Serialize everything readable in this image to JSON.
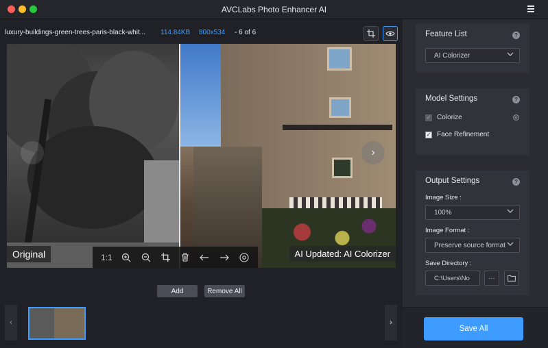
{
  "window": {
    "title": "AVCLabs Photo Enhancer AI"
  },
  "file_info": {
    "name": "luxury-buildings-green-trees-paris-black-whit...",
    "size": "114.84KB",
    "dimensions": "800x534",
    "position": "- 6 of 6"
  },
  "viewer": {
    "label_original": "Original",
    "label_ai": "AI Updated: AI Colorizer",
    "zoom_label": "1:1",
    "next_glyph": "›"
  },
  "actions": {
    "add_label": "Add",
    "remove_all_label": "Remove All"
  },
  "thumbnail_strip": {
    "prev_glyph": "‹",
    "next_glyph": "›"
  },
  "feature_list": {
    "title": "Feature List",
    "help": "?",
    "selected": "AI Colorizer"
  },
  "model_settings": {
    "title": "Model Settings",
    "help": "?",
    "options": [
      {
        "label": "Colorize",
        "checked": true,
        "disabled": true
      },
      {
        "label": "Face Refinement",
        "checked": true,
        "disabled": false
      }
    ],
    "check_glyph": "✓"
  },
  "output_settings": {
    "title": "Output Settings",
    "help": "?",
    "image_size_label": "Image Size :",
    "image_size_value": "100%",
    "image_format_label": "Image Format :",
    "image_format_value": "Preserve source format",
    "save_directory_label": "Save Directory :",
    "save_directory_value": "C:\\Users\\No",
    "browse_label": "···"
  },
  "save_all_label": "Save All",
  "colors": {
    "accent": "#3e9bff",
    "panel_bg": "#2a2c31",
    "card_bg": "#30333a",
    "work_bg": "#1f2126"
  }
}
